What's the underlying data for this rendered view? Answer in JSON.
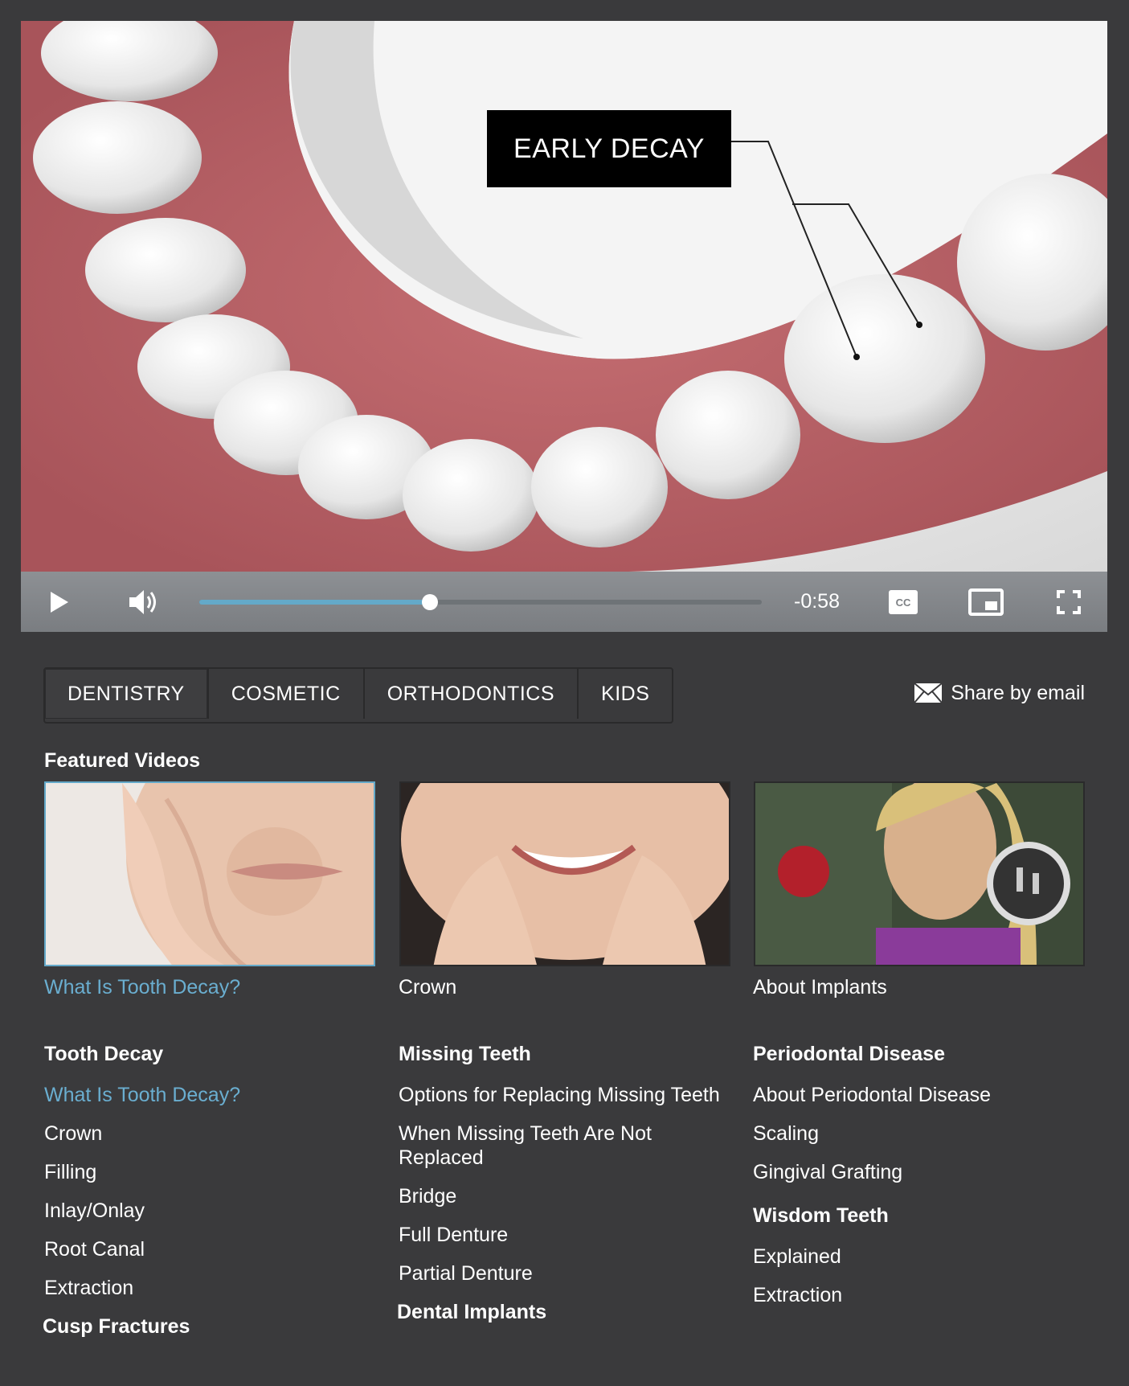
{
  "video": {
    "callout_text": "EARLY DECAY",
    "time_remaining": "-0:58",
    "progress": 0.41,
    "controls": {
      "play_icon": "play-icon",
      "volume_icon": "volume-icon",
      "cc_icon": "closed-captions-icon",
      "pip_icon": "picture-in-picture-icon",
      "fullscreen_icon": "fullscreen-icon"
    }
  },
  "tabs": [
    {
      "label": "DENTISTRY",
      "active": true
    },
    {
      "label": "COSMETIC",
      "active": false
    },
    {
      "label": "ORTHODONTICS",
      "active": false
    },
    {
      "label": "KIDS",
      "active": false
    }
  ],
  "share": {
    "label": "Share by email",
    "icon": "envelope-icon"
  },
  "featured": {
    "title": "Featured Videos",
    "items": [
      {
        "caption": "What Is Tooth Decay?",
        "active": true
      },
      {
        "caption": "Crown",
        "active": false
      },
      {
        "caption": "About Implants",
        "active": false
      }
    ]
  },
  "topics": {
    "col1": {
      "heading": "Tooth Decay",
      "links": [
        "What Is Tooth Decay?",
        "Crown",
        "Filling",
        "Inlay/Onlay",
        "Root Canal",
        "Extraction"
      ],
      "heading2": "Cusp Fractures"
    },
    "col2": {
      "heading": "Missing Teeth",
      "links": [
        "Options for Replacing Missing Teeth",
        "When Missing Teeth Are Not Replaced",
        "Bridge",
        "Full Denture",
        "Partial Denture"
      ],
      "heading2": "Dental Implants"
    },
    "col3": {
      "heading": "Periodontal Disease",
      "links": [
        "About Periodontal Disease",
        "Scaling",
        "Gingival Grafting"
      ],
      "heading2": "Wisdom Teeth",
      "links2": [
        "Explained",
        "Extraction"
      ]
    }
  },
  "colors": {
    "accent": "#6aaed0",
    "background": "#3a3a3c"
  }
}
